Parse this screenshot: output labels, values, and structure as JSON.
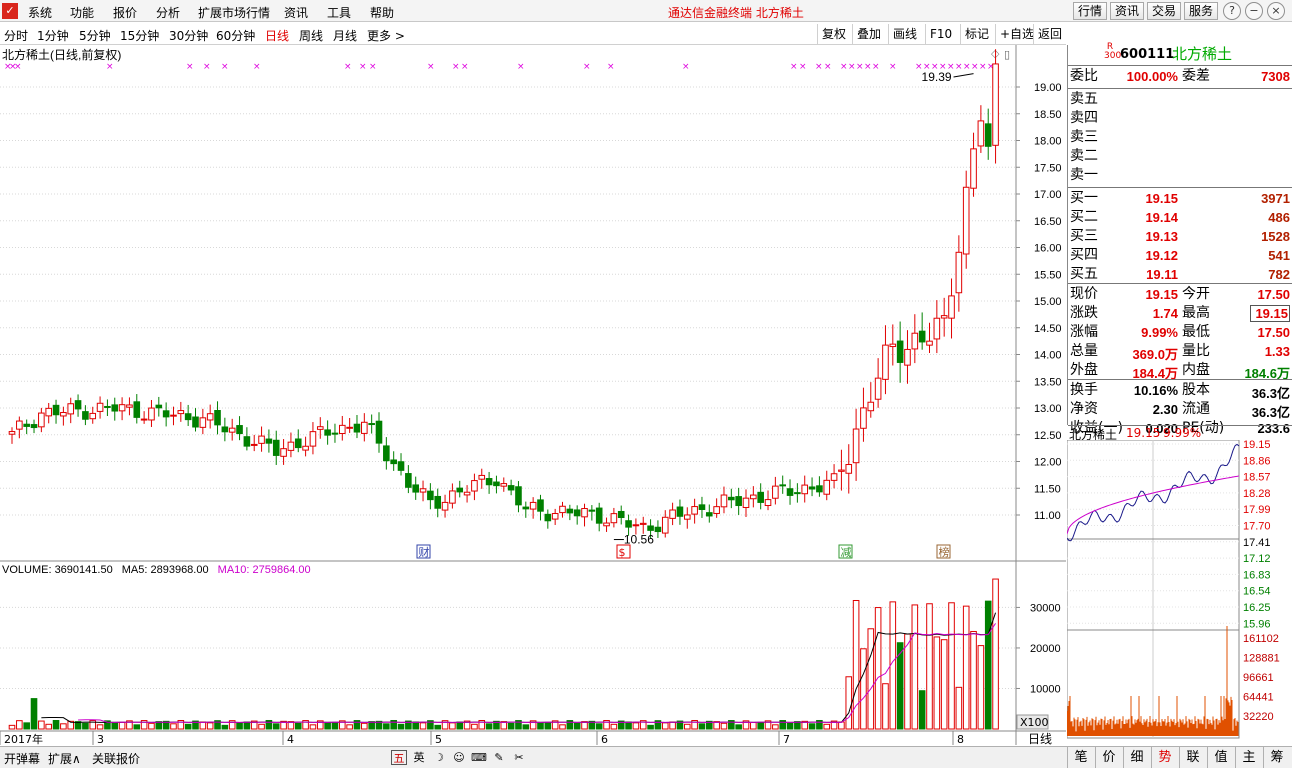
{
  "menu": {
    "logo": "✓",
    "items": [
      "系统",
      "功能",
      "报价",
      "分析",
      "扩展市场行情",
      "资讯",
      "工具",
      "帮助"
    ],
    "app_title": "通达信金融终端  北方稀土",
    "right_buttons": [
      "行情",
      "资讯",
      "交易",
      "服务"
    ],
    "window_buttons": [
      "?",
      "−",
      "□",
      "×"
    ]
  },
  "toolbar": {
    "periods": [
      "分时",
      "1分钟",
      "5分钟",
      "15分钟",
      "30分钟",
      "60分钟",
      "日线",
      "周线",
      "月线",
      "更多 >"
    ],
    "active_period": "日线",
    "tools": [
      "复权",
      "叠加",
      "画线",
      "F10",
      "标记",
      "+自选",
      "返回"
    ]
  },
  "chart": {
    "title": "北方稀土(日线,前复权)",
    "price_ticks": [
      "19.00",
      "18.50",
      "18.00",
      "17.50",
      "17.00",
      "16.50",
      "16.00",
      "15.50",
      "15.00",
      "14.50",
      "14.00",
      "13.50",
      "13.00",
      "12.50",
      "12.00",
      "11.50",
      "11.00"
    ],
    "high_label": "19.39",
    "low_label": "10.56",
    "event_markers": [
      {
        "label": "财",
        "color": "#3344aa"
      },
      {
        "label": "$",
        "color": "#e00000"
      },
      {
        "label": "减",
        "color": "#339933"
      },
      {
        "label": "榜",
        "color": "#996633"
      }
    ],
    "volume_header": {
      "volume": "VOLUME: 3690141.50",
      "ma5": "MA5: 2893968.00",
      "ma10": "MA10: 2759864.00"
    },
    "volume_ticks": [
      "30000",
      "20000",
      "10000"
    ],
    "volume_unit": "X100",
    "date_labels": [
      "2017年",
      "3",
      "4",
      "5",
      "6",
      "7",
      "8"
    ],
    "period_label": "日线"
  },
  "colors": {
    "up": "#e00000",
    "down": "#008000",
    "marker": "#dd00dd",
    "ma10": "#cc00cc",
    "ma5": "#000000"
  },
  "quote": {
    "code_prefix": "R\n300",
    "code": "600111",
    "name": "北方稀土",
    "weibi_label": "委比",
    "weibi": "100.00%",
    "weicha_label": "委差",
    "weicha": "7308",
    "sell_levels": [
      "卖五",
      "卖四",
      "卖三",
      "卖二",
      "卖一"
    ],
    "buy_levels": [
      {
        "label": "买一",
        "price": "19.15",
        "vol": "3971"
      },
      {
        "label": "买二",
        "price": "19.14",
        "vol": "486"
      },
      {
        "label": "买三",
        "price": "19.13",
        "vol": "1528"
      },
      {
        "label": "买四",
        "price": "19.12",
        "vol": "541"
      },
      {
        "label": "买五",
        "price": "19.11",
        "vol": "782"
      }
    ],
    "stats": [
      {
        "l1": "现价",
        "v1": "19.15",
        "l2": "今开",
        "v2": "17.50",
        "c1": "red",
        "c2": "red"
      },
      {
        "l1": "涨跌",
        "v1": "1.74",
        "l2": "最高",
        "v2": "19.15",
        "c1": "red",
        "c2": "red"
      },
      {
        "l1": "涨幅",
        "v1": "9.99%",
        "l2": "最低",
        "v2": "17.50",
        "c1": "red",
        "c2": "red"
      },
      {
        "l1": "总量",
        "v1": "369.0万",
        "l2": "量比",
        "v2": "1.33",
        "c1": "red",
        "c2": "red"
      },
      {
        "l1": "外盘",
        "v1": "184.4万",
        "l2": "内盘",
        "v2": "184.6万",
        "c1": "red",
        "c2": "green"
      }
    ],
    "fundamentals": [
      {
        "l1": "换手",
        "v1": "10.16%",
        "l2": "股本",
        "v2": "36.3亿"
      },
      {
        "l1": "净资",
        "v1": "2.30",
        "l2": "流通",
        "v2": "36.3亿"
      },
      {
        "l1": "收益(一)",
        "v1": "0.020",
        "l2": "PE(动)",
        "v2": "233.6"
      }
    ]
  },
  "mini": {
    "name": "北方稀土",
    "price": "19.15",
    "pct": "9.99%",
    "price_ticks": [
      "19.15",
      "18.86",
      "18.57",
      "18.28",
      "17.99",
      "17.70",
      "17.41",
      "17.12",
      "16.83",
      "16.54",
      "16.25",
      "15.96"
    ],
    "vol_ticks": [
      "161102",
      "128881",
      "96661",
      "64441",
      "32220"
    ]
  },
  "bottom": {
    "tabs": [
      "开弹幕",
      "扩展∧",
      "关联报价"
    ],
    "icons": [
      "五",
      "英",
      "☽",
      "☺",
      "⌨",
      "✎",
      "✂"
    ],
    "right_tabs": [
      "笔",
      "价",
      "细",
      "势",
      "联",
      "值",
      "主",
      "筹"
    ],
    "active_right_tab": "势"
  }
}
